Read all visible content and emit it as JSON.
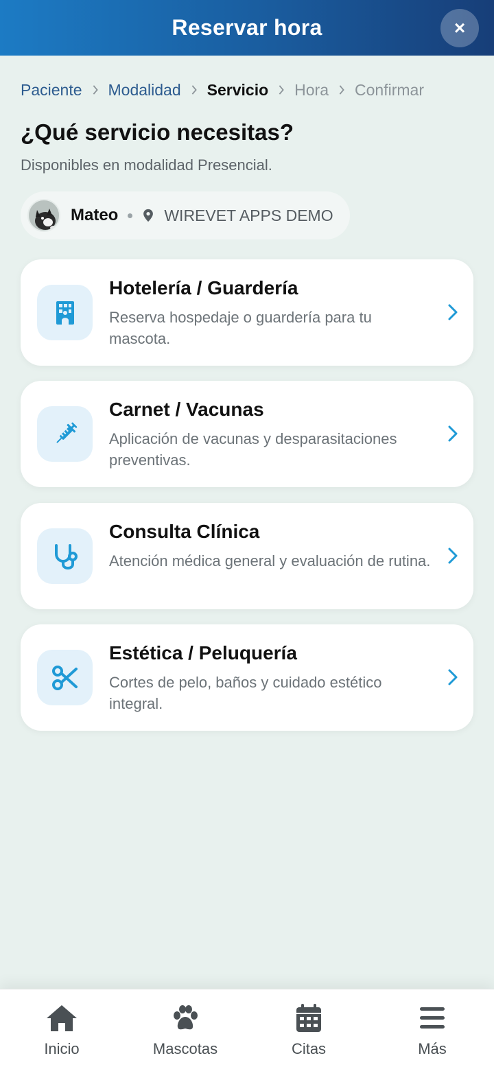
{
  "header": {
    "title": "Reservar hora",
    "close_label": "×"
  },
  "breadcrumb": [
    {
      "label": "Paciente",
      "state": "done"
    },
    {
      "label": "Modalidad",
      "state": "done"
    },
    {
      "label": "Servicio",
      "state": "current"
    },
    {
      "label": "Hora",
      "state": "todo"
    },
    {
      "label": "Confirmar",
      "state": "todo"
    }
  ],
  "page": {
    "title": "¿Qué servicio necesitas?",
    "subtitle": "Disponibles en modalidad Presencial."
  },
  "patient": {
    "name": "Mateo",
    "clinic": "WIREVET APPS DEMO",
    "location_icon": "location-pin-icon"
  },
  "services": [
    {
      "title": "Hotelería / Guardería",
      "description": "Reserva hospedaje o guardería para tu mascota.",
      "icon": "hotel-icon"
    },
    {
      "title": "Carnet / Vacunas",
      "description": "Aplicación de vacunas y desparasitaciones preventivas.",
      "icon": "syringe-icon"
    },
    {
      "title": "Consulta Clínica",
      "description": "Atención médica general y evaluación de rutina.",
      "icon": "stethoscope-icon"
    },
    {
      "title": "Estética / Peluquería",
      "description": "Cortes de pelo, baños y cuidado estético integral.",
      "icon": "scissors-icon"
    }
  ],
  "bottom_nav": [
    {
      "label": "Inicio",
      "icon": "home-icon"
    },
    {
      "label": "Mascotas",
      "icon": "paw-icon"
    },
    {
      "label": "Citas",
      "icon": "calendar-icon"
    },
    {
      "label": "Más",
      "icon": "menu-icon"
    }
  ],
  "colors": {
    "accent": "#1f9ad6",
    "header_start": "#1c7bc4",
    "header_end": "#173e78",
    "background": "#e8f1ee",
    "icon_tile": "#e3f1fa"
  }
}
